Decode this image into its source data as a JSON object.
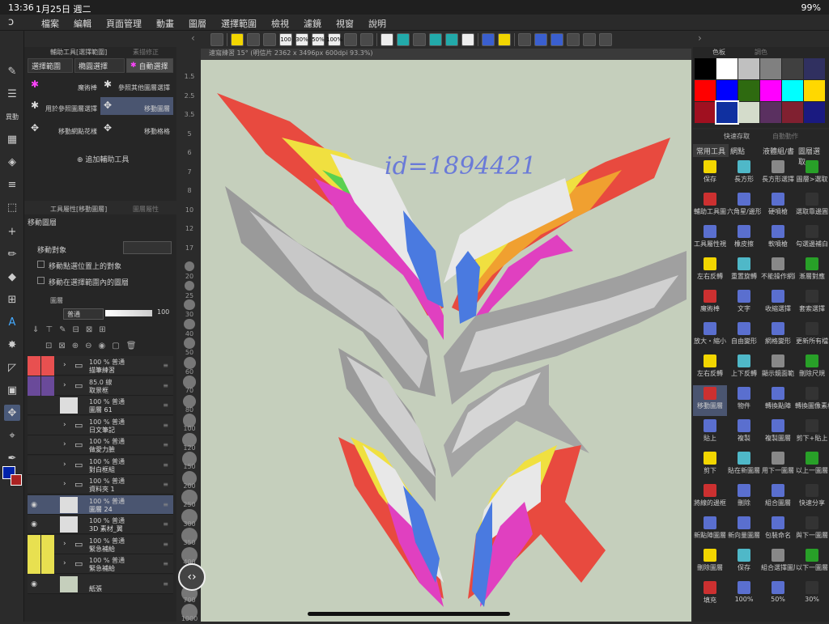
{
  "status": {
    "time": "13:36",
    "date": "1月25日 週二",
    "battery": "99%"
  },
  "menu": [
    "檔案",
    "編輯",
    "頁面管理",
    "動畫",
    "圖層",
    "選擇範圍",
    "檢視",
    "濾鏡",
    "視窗",
    "說明"
  ],
  "toolbar": {
    "pct1": "100",
    "pct2": "30%",
    "pct3": "50%",
    "pct4": "100%"
  },
  "subtool": {
    "title": "輔助工具[選擇範圍]",
    "title2": "素描修正",
    "tabs": [
      "選擇範圍",
      "橢圓選擇",
      "自動選擇"
    ],
    "items": [
      "魔術棒",
      "參照其他圖層選擇",
      "用於參照圖層選擇",
      "移動圖層",
      "移動網點花樣",
      "移動格格"
    ],
    "add": "追加輔助工具"
  },
  "property": {
    "title": "工具屬性[移動圖層]",
    "title2": "圖層屬性",
    "subtitle": "移動圖層",
    "move_target": "移動對象",
    "opt1": "移動點選位置上的對象",
    "opt2": "移動在選擇範圍內的圖層"
  },
  "layers": {
    "title": "圖層",
    "blend": "普通",
    "opacity": "100",
    "rows": [
      {
        "l1": "100 % 普通",
        "l2": "描筆練習"
      },
      {
        "l1": "85.0 線",
        "l2": "取景框"
      },
      {
        "l1": "100 % 普通",
        "l2": "圖層 61"
      },
      {
        "l1": "100 % 普通",
        "l2": "日文筆記"
      },
      {
        "l1": "100 % 普通",
        "l2": "做愛力臉"
      },
      {
        "l1": "100 % 普通",
        "l2": "對白框組"
      },
      {
        "l1": "100 % 普通",
        "l2": "資料夾 1"
      },
      {
        "l1": "100 % 普通",
        "l2": "圖層 24"
      },
      {
        "l1": "100 % 普通",
        "l2": "3D 素材_翼"
      },
      {
        "l1": "100 % 普通",
        "l2": "緊急補給"
      },
      {
        "l1": "100 % 普通",
        "l2": "緊急補給"
      },
      {
        "l1": "",
        "l2": "紙張"
      }
    ]
  },
  "canvas": {
    "header": "速寫練習 15° (明信片 2362 x 3496px 600dpi 93.3%)",
    "idtext": "id=1894421"
  },
  "ruler": [
    "1.5",
    "2.5",
    "3.5",
    "5",
    "6",
    "7",
    "8",
    "10",
    "12",
    "17",
    "20",
    "25",
    "30",
    "40",
    "50",
    "60",
    "70",
    "80",
    "100",
    "120",
    "150",
    "200",
    "250",
    "300",
    "350",
    "400",
    "500",
    "700",
    "1000"
  ],
  "palette": {
    "title": "色板",
    "title2": "調色",
    "colors": [
      "#000000",
      "#ffffff",
      "#c0c0c0",
      "#808080",
      "#404040",
      "#303060",
      "#ff0000",
      "#0000ff",
      "#2e6a10",
      "#ff00ff",
      "#00ffff",
      "#ffd800",
      "#a01020",
      "#1030a0",
      "#d4dccb",
      "#5a3060",
      "#802030",
      "#1a1a80"
    ]
  },
  "qa": {
    "title": "快速存取",
    "title2": "自動動作",
    "tabs": [
      "常用工具",
      "網點",
      "液體組/書",
      "圖層選取"
    ],
    "items": [
      "保存",
      "長方形",
      "長方形選擇",
      "圖層>選取",
      "輔助工具圖",
      "六角星/邊形",
      "硬噴槍",
      "選取靠邊圓",
      "工具屬性視",
      "橡皮擦",
      "軟噴槍",
      "勾選邊補白",
      "左右反轉",
      "重置旋轉",
      "不能操作網點",
      "漸層對應",
      "魔術棒",
      "文字",
      "收縮選擇",
      "套索選擇",
      "放大・縮小",
      "自由變形",
      "網格變形",
      "更新所有檔",
      "左右反轉",
      "上下反轉",
      "顯示鏡面範",
      "刪除尺規",
      "移動圖層",
      "物件",
      "轉換點陣",
      "轉換圖像素材",
      "貼上",
      "複製",
      "複製圖層",
      "剪下+貼上",
      "剪下",
      "貼在新圖層",
      "用下一圖層",
      "以上一圖層",
      "將線的邊框",
      "刪除",
      "組合圖層",
      "快速分享",
      "新點陣圖層",
      "新向量圖層",
      "包裝命名",
      "與下一圖層",
      "刪除圖層",
      "保存",
      "組合選擇圖層",
      "以下一圖層",
      "填充",
      "100%",
      "50%",
      "30%"
    ]
  }
}
